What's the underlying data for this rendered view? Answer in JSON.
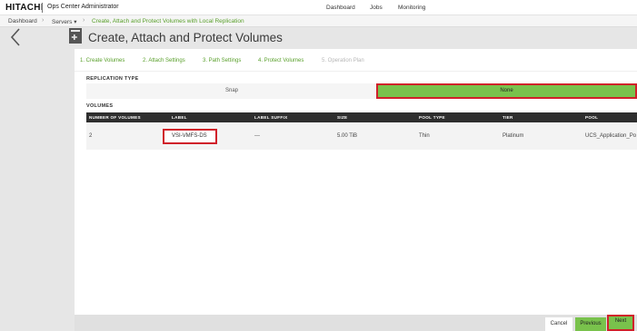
{
  "topbar": {
    "brand": "HITACHI",
    "app_name": "Ops Center Administrator",
    "nav": [
      "Dashboard",
      "Jobs",
      "Monitoring"
    ]
  },
  "breadcrumb": {
    "items": [
      "Dashboard",
      "Servers ▾",
      "Create, Attach and Protect Volumes with Local Replication"
    ]
  },
  "page": {
    "title": "Create, Attach and Protect Volumes"
  },
  "steps": [
    "1. Create Volumes",
    "2. Attach Settings",
    "3. Path Settings",
    "4. Protect Volumes",
    "5. Operation Plan"
  ],
  "replication": {
    "heading": "REPLICATION TYPE",
    "options": [
      "Snap",
      "None"
    ],
    "selected": "None"
  },
  "volumes": {
    "heading": "VOLUMES",
    "columns": [
      "NUMBER OF VOLUMES",
      "LABEL",
      "LABEL SUFFIX",
      "SIZE",
      "POOL TYPE",
      "TIER",
      "POOL"
    ],
    "row": {
      "count": "2",
      "label": "VSI-VMFS-DS",
      "suffix": "---",
      "size": "5.00 TiB",
      "pool_type": "Thin",
      "tier": "Platinum",
      "pool": "UCS_Application_Po"
    }
  },
  "footer": {
    "cancel": "Cancel",
    "previous": "Previous",
    "next": "Next"
  },
  "colors": {
    "accent_green": "#79c24c",
    "link_green": "#5aa02c",
    "highlight_red": "#d0202a",
    "table_header": "#2e2e2e"
  }
}
